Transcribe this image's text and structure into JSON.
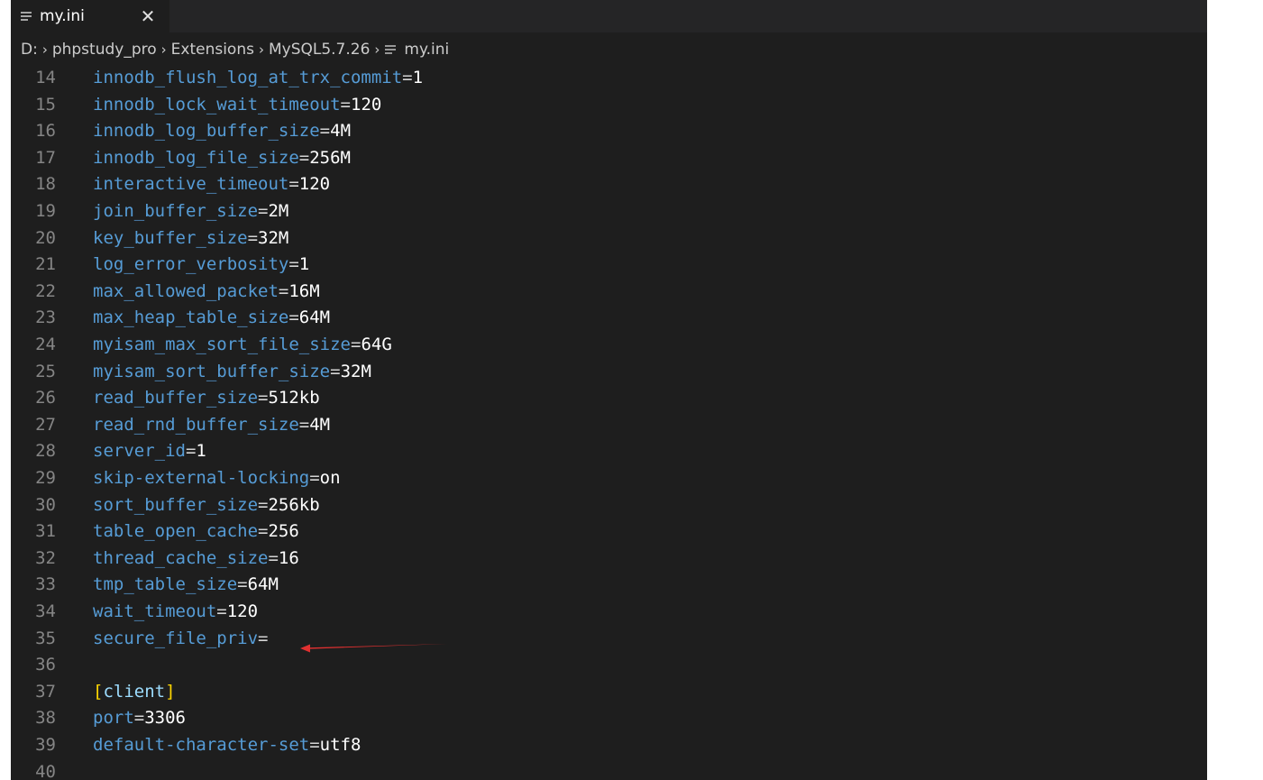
{
  "tab": {
    "label": "my.ini",
    "close_glyph": "✕",
    "icon": "lines-file-icon"
  },
  "breadcrumb": {
    "items": [
      "D:",
      "phpstudy_pro",
      "Extensions",
      "MySQL5.7.26",
      "my.ini"
    ],
    "separator": "›"
  },
  "colors": {
    "key": "#569cd6",
    "value": "#ffffff",
    "bracket": "#ffd700",
    "arrow": "#e03030"
  },
  "lines": [
    {
      "n": "14",
      "key": "innodb_flush_log_at_trx_commit",
      "eq": "=",
      "val": "1"
    },
    {
      "n": "15",
      "key": "innodb_lock_wait_timeout",
      "eq": "=",
      "val": "120"
    },
    {
      "n": "16",
      "key": "innodb_log_buffer_size",
      "eq": "=",
      "val": "4M"
    },
    {
      "n": "17",
      "key": "innodb_log_file_size",
      "eq": "=",
      "val": "256M"
    },
    {
      "n": "18",
      "key": "interactive_timeout",
      "eq": "=",
      "val": "120"
    },
    {
      "n": "19",
      "key": "join_buffer_size",
      "eq": "=",
      "val": "2M"
    },
    {
      "n": "20",
      "key": "key_buffer_size",
      "eq": "=",
      "val": "32M"
    },
    {
      "n": "21",
      "key": "log_error_verbosity",
      "eq": "=",
      "val": "1"
    },
    {
      "n": "22",
      "key": "max_allowed_packet",
      "eq": "=",
      "val": "16M"
    },
    {
      "n": "23",
      "key": "max_heap_table_size",
      "eq": "=",
      "val": "64M"
    },
    {
      "n": "24",
      "key": "myisam_max_sort_file_size",
      "eq": "=",
      "val": "64G"
    },
    {
      "n": "25",
      "key": "myisam_sort_buffer_size",
      "eq": "=",
      "val": "32M"
    },
    {
      "n": "26",
      "key": "read_buffer_size",
      "eq": "=",
      "val": "512kb"
    },
    {
      "n": "27",
      "key": "read_rnd_buffer_size",
      "eq": "=",
      "val": "4M"
    },
    {
      "n": "28",
      "key": "server_id",
      "eq": "=",
      "val": "1"
    },
    {
      "n": "29",
      "key": "skip-external-locking",
      "eq": "=",
      "val": "on"
    },
    {
      "n": "30",
      "key": "sort_buffer_size",
      "eq": "=",
      "val": "256kb"
    },
    {
      "n": "31",
      "key": "table_open_cache",
      "eq": "=",
      "val": "256"
    },
    {
      "n": "32",
      "key": "thread_cache_size",
      "eq": "=",
      "val": "16"
    },
    {
      "n": "33",
      "key": "tmp_table_size",
      "eq": "=",
      "val": "64M"
    },
    {
      "n": "34",
      "key": "wait_timeout",
      "eq": "=",
      "val": "120"
    },
    {
      "n": "35",
      "key": "secure_file_priv",
      "eq": "=",
      "val": ""
    },
    {
      "n": "36",
      "key": "",
      "eq": "",
      "val": ""
    },
    {
      "n": "37",
      "section": "client",
      "open": "[",
      "close": "]"
    },
    {
      "n": "38",
      "key": "port",
      "eq": "=",
      "val": "3306"
    },
    {
      "n": "39",
      "key": "default-character-set",
      "eq": "=",
      "val": "utf8"
    },
    {
      "n": "40",
      "key": "",
      "eq": "",
      "val": ""
    }
  ]
}
